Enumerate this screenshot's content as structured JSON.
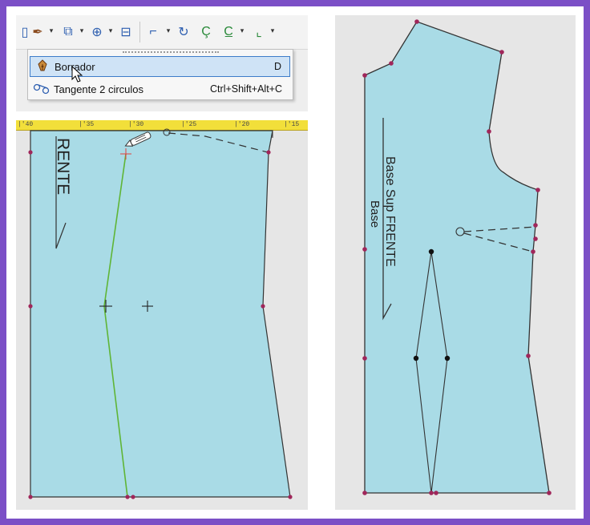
{
  "menu": {
    "items": [
      {
        "label": "Borrador",
        "shortcut": "D",
        "icon": "pen-nib-icon",
        "selected": true
      },
      {
        "label": "Tangente 2 circulos",
        "shortcut": "Ctrl+Shift+Alt+C",
        "icon": "tangent-circles-icon",
        "selected": false
      }
    ]
  },
  "left_canvas": {
    "piece_label": "RENTE",
    "ruler_ticks": [
      "|'40",
      "|'35",
      "|'30",
      "|'25",
      "|'20",
      "|'15"
    ]
  },
  "right_canvas": {
    "piece_label_line1": "Base Sup FRENTE",
    "piece_label_line2": "Base"
  },
  "colors": {
    "pattern_fill": "#a9dbe6",
    "point_marker": "#a0265a",
    "accent_border": "#7b4fc6",
    "ruler": "#f2df3a"
  }
}
